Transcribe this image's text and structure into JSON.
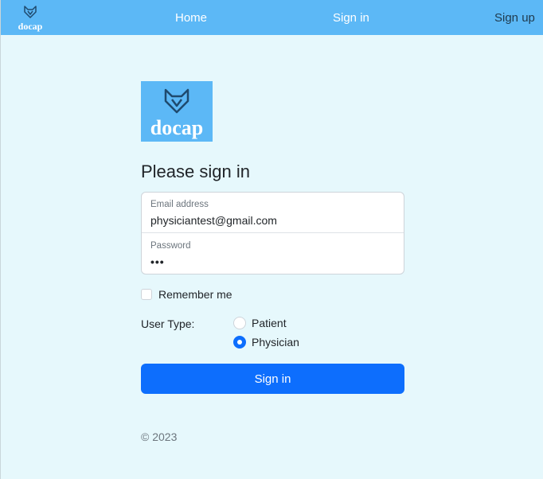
{
  "navbar": {
    "logo_text": "docap",
    "links": [
      {
        "label": "Home"
      },
      {
        "label": "Sign in"
      },
      {
        "label": "Sign up"
      }
    ]
  },
  "brand": {
    "logo_text": "docap",
    "icon": "fox-head-icon"
  },
  "form": {
    "heading": "Please sign in",
    "email": {
      "label": "Email address",
      "value": "physiciantest@gmail.com"
    },
    "password": {
      "label": "Password",
      "value": "•••"
    },
    "remember_label": "Remember me",
    "remember_checked": false,
    "user_type_label": "User Type:",
    "user_types": [
      {
        "label": "Patient",
        "checked": false
      },
      {
        "label": "Physician",
        "checked": true
      }
    ],
    "submit_label": "Sign in"
  },
  "footer": {
    "text": "© 2023"
  },
  "colors": {
    "navbar_bg": "#5cb8f6",
    "page_bg": "#e6f8fc",
    "primary": "#0d6efd"
  }
}
